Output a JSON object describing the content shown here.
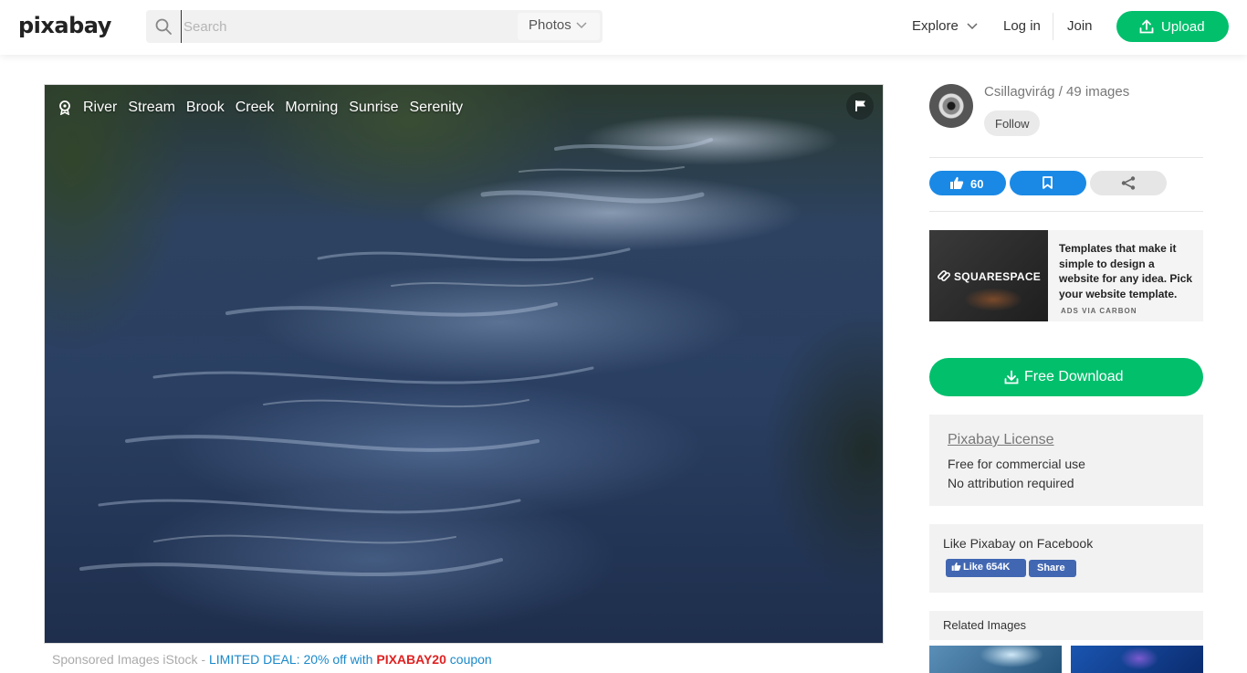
{
  "header": {
    "logo": "pixabay",
    "search_placeholder": "Search",
    "search_type": "Photos",
    "explore": "Explore",
    "login": "Log in",
    "join": "Join",
    "upload": "Upload"
  },
  "photo": {
    "tags": [
      "River",
      "Stream",
      "Brook",
      "Creek",
      "Morning",
      "Sunrise",
      "Serenity"
    ],
    "icons": {
      "tag": "map-pin-icon",
      "report": "flag-icon"
    }
  },
  "sponsored": {
    "prefix": "Sponsored Images iStock - ",
    "deal": "LIMITED DEAL: 20% off with ",
    "code": "PIXABAY20",
    "suffix": " coupon"
  },
  "author": {
    "name": "Csillagvirág / 49 images",
    "follow": "Follow"
  },
  "actions": {
    "likes": "60"
  },
  "ad": {
    "brand": "SQUARESPACE",
    "text": "Templates that make it simple to design a website for any idea. Pick your website template.",
    "via": "ADS VIA CARBON"
  },
  "download": {
    "label": "Free Download"
  },
  "license": {
    "title": "Pixabay License",
    "line1": "Free for commercial use",
    "line2": "No attribution required"
  },
  "facebook": {
    "title": "Like Pixabay on Facebook",
    "like": "Like 654K",
    "share": "Share"
  },
  "related": {
    "title": "Related Images"
  },
  "colors": {
    "primary_green": "#02bf6c",
    "action_blue": "#1a89e6",
    "facebook_blue": "#4267b2"
  }
}
